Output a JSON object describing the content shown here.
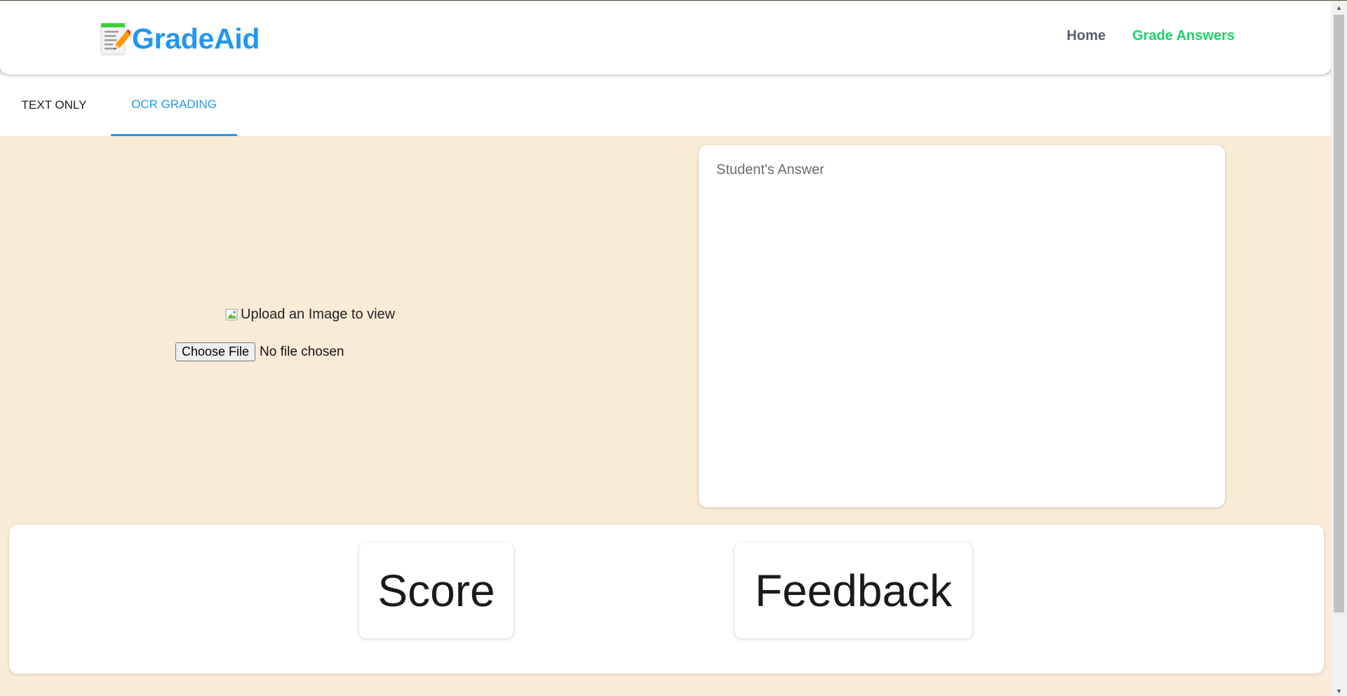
{
  "header": {
    "brand": "GradeAid",
    "nav": {
      "home": "Home",
      "grade_answers": "Grade Answers"
    }
  },
  "tabs": [
    {
      "label": "TEXT ONLY",
      "active": false
    },
    {
      "label": "OCR GRADING",
      "active": true
    }
  ],
  "upload": {
    "image_alt": "Upload an Image to view",
    "choose_button": "Choose File",
    "file_status": "No file chosen"
  },
  "answer": {
    "label": "Student's Answer"
  },
  "results": {
    "score_label": "Score",
    "feedback_label": "Feedback"
  },
  "colors": {
    "brand": "#2196f3",
    "nav_active": "#1fd16b",
    "background": "#faebd7"
  }
}
